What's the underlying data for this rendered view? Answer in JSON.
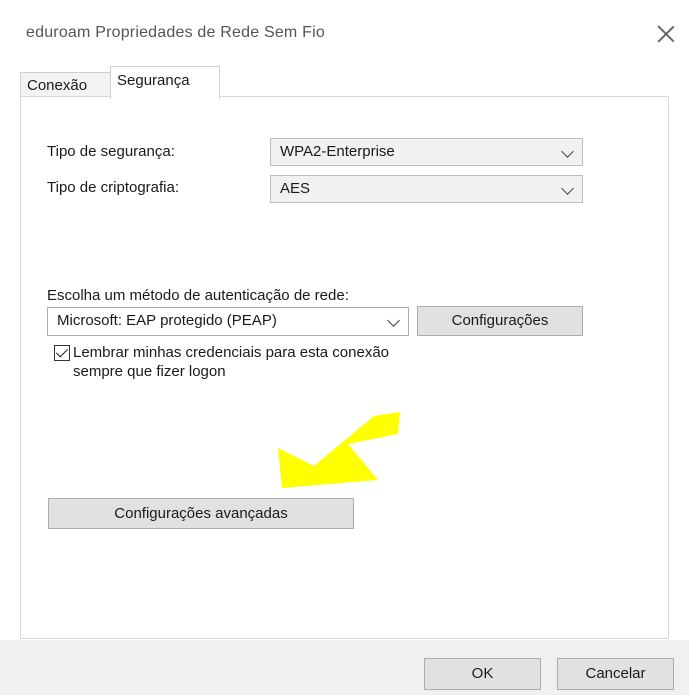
{
  "window": {
    "title": "eduroam Propriedades de Rede Sem Fio"
  },
  "tabs": [
    {
      "label": "Conexão",
      "active": false
    },
    {
      "label": "Segurança",
      "active": true
    }
  ],
  "security": {
    "type_label": "Tipo de segurança:",
    "type_value": "WPA2-Enterprise",
    "encryption_label": "Tipo de criptografia:",
    "encryption_value": "AES"
  },
  "auth": {
    "label": "Escolha um método de autenticação de rede:",
    "method_value": "Microsoft: EAP protegido (PEAP)",
    "settings_button": "Configurações",
    "remember_line1": "Lembrar minhas credenciais para esta conexão",
    "remember_line2": "sempre que fizer logon",
    "remember_checked": true
  },
  "advanced_button": "Configurações avançadas",
  "annotation": {
    "arrow_color": "#ffff00"
  },
  "footer": {
    "ok": "OK",
    "cancel": "Cancelar"
  }
}
